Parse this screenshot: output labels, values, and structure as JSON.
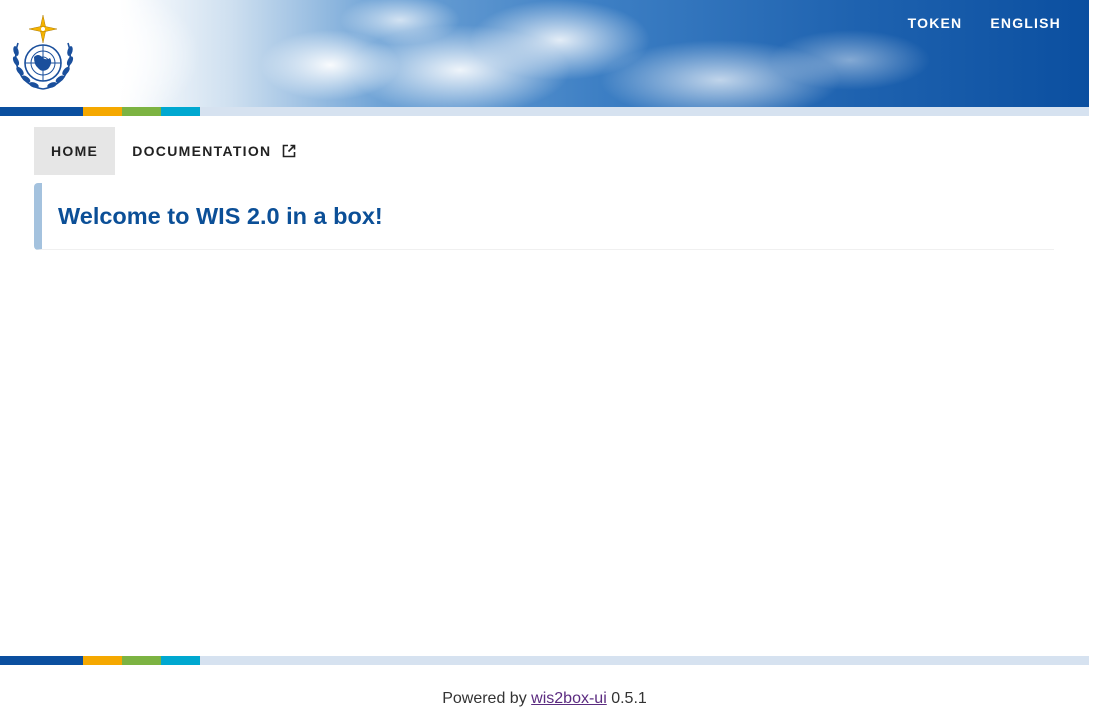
{
  "header": {
    "nav": [
      {
        "label": "TOKEN"
      },
      {
        "label": "ENGLISH"
      }
    ],
    "logo_icon": "wmo-emblem-icon"
  },
  "stripe_colors": [
    "#0b4f9f",
    "#f5a800",
    "#7cb342",
    "#00a8d0",
    "#d6e2f0"
  ],
  "tabs": [
    {
      "label": "HOME",
      "active": true
    },
    {
      "label": "DOCUMENTATION",
      "active": false,
      "icon": "external-link-icon"
    }
  ],
  "main": {
    "title": "Welcome to WIS 2.0 in a box!"
  },
  "footer": {
    "prefix": "Powered by",
    "link_text": "wis2box-ui",
    "version": "0.5.1"
  },
  "colors": {
    "title": "#0b4f97",
    "accent_border": "#a4c2de",
    "link": "#5b2b80"
  }
}
